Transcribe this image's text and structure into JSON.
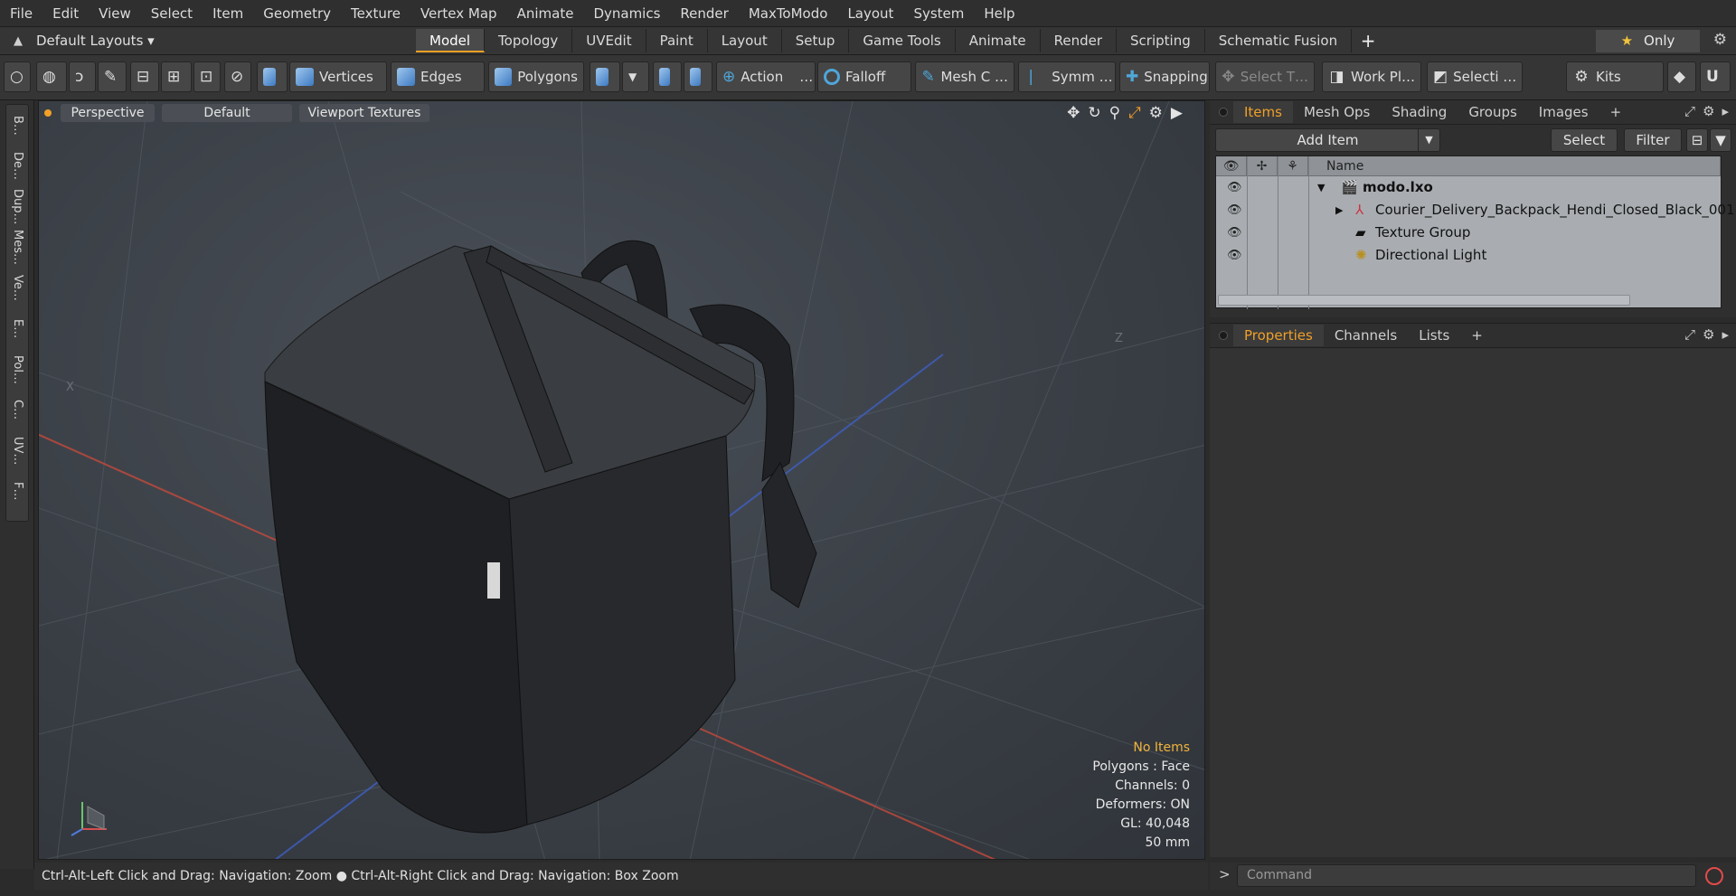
{
  "menu": [
    "File",
    "Edit",
    "View",
    "Select",
    "Item",
    "Geometry",
    "Texture",
    "Vertex Map",
    "Animate",
    "Dynamics",
    "Render",
    "MaxToModo",
    "Layout",
    "System",
    "Help"
  ],
  "layout_bar": {
    "layouts_label": "Default Layouts ▾",
    "tabs": [
      "Model",
      "Topology",
      "UVEdit",
      "Paint",
      "Layout",
      "Setup",
      "Game Tools",
      "Animate",
      "Render",
      "Scripting",
      "Schematic Fusion"
    ],
    "active_tab": "Model",
    "add_tab": "+",
    "only_label": "Only"
  },
  "toolbar": {
    "vertices": "Vertices",
    "edges": "Edges",
    "polygons": "Polygons",
    "action": "Action",
    "action_more": "…",
    "falloff": "Falloff",
    "mesh_c": "Mesh C …",
    "symm": "Symm …",
    "snapping": "Snapping",
    "select_t": "Select T…",
    "work_pl": "Work Pl…",
    "selecti": "Selecti …",
    "kits": "Kits"
  },
  "left_tabs": [
    "B…",
    "De…",
    "Dup…",
    "Mes…",
    "Ve…",
    "E…",
    "Pol…",
    "C…",
    "UV…",
    "F…"
  ],
  "viewport": {
    "perspective": "Perspective",
    "default": "Default",
    "textures": "Viewport Textures",
    "axis_x": "X",
    "axis_z": "Z",
    "info": {
      "no_items": "No Items",
      "polygons": "Polygons : Face",
      "channels": "Channels: 0",
      "deformers": "Deformers: ON",
      "gl": "GL: 40,048",
      "size": "50 mm"
    }
  },
  "status_bar": "Ctrl-Alt-Left Click and Drag: Navigation: Zoom ● Ctrl-Alt-Right Click and Drag: Navigation: Box Zoom",
  "items_panel": {
    "tabs": [
      "Items",
      "Mesh Ops",
      "Shading",
      "Groups",
      "Images"
    ],
    "active_tab": "Items",
    "add_tab": "+",
    "add_item": "Add Item",
    "select": "Select",
    "filter": "Filter",
    "col_name": "Name",
    "rows": [
      {
        "label": "modo.lxo"
      },
      {
        "label": "Courier_Delivery_Backpack_Hendi_Closed_Black_001"
      },
      {
        "label": "Texture Group"
      },
      {
        "label": "Directional Light"
      }
    ]
  },
  "properties_panel": {
    "tabs": [
      "Properties",
      "Channels",
      "Lists"
    ],
    "active_tab": "Properties",
    "add_tab": "+"
  },
  "command": {
    "prompt": ">",
    "placeholder": "Command"
  }
}
